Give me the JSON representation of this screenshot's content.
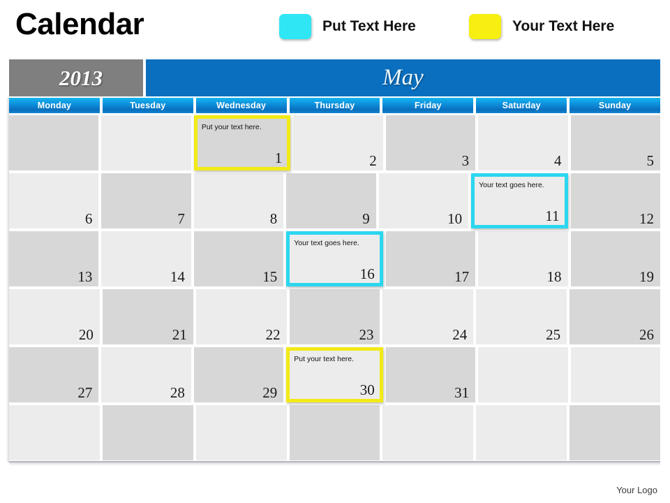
{
  "slide": {
    "title": "Calendar",
    "footer_logo": "Your Logo"
  },
  "legend": {
    "items": [
      {
        "label": "Put Text Here",
        "color": "#2fe6f5",
        "name": "cyan"
      },
      {
        "label": "Your Text Here",
        "color": "#f6ef10",
        "name": "yellow"
      }
    ]
  },
  "header": {
    "year": "2013",
    "month": "May",
    "year_bg": "#7f7f7f",
    "month_bg": "#0a6fbe"
  },
  "weekdays": [
    "Monday",
    "Tuesday",
    "Wednesday",
    "Thursday",
    "Friday",
    "Saturday",
    "Sunday"
  ],
  "notes": {
    "yellow_note": "Put your text here.",
    "cyan_note": "Your text goes here."
  },
  "weeks": [
    [
      {
        "day": "",
        "tone": "dark",
        "highlight": "none",
        "note": ""
      },
      {
        "day": "",
        "tone": "light",
        "highlight": "none",
        "note": ""
      },
      {
        "day": "1",
        "tone": "dark",
        "highlight": "yellow",
        "note": "Put your text here."
      },
      {
        "day": "2",
        "tone": "light",
        "highlight": "none",
        "note": ""
      },
      {
        "day": "3",
        "tone": "dark",
        "highlight": "none",
        "note": ""
      },
      {
        "day": "4",
        "tone": "light",
        "highlight": "none",
        "note": ""
      },
      {
        "day": "5",
        "tone": "dark",
        "highlight": "none",
        "note": ""
      }
    ],
    [
      {
        "day": "6",
        "tone": "light",
        "highlight": "none",
        "note": ""
      },
      {
        "day": "7",
        "tone": "dark",
        "highlight": "none",
        "note": ""
      },
      {
        "day": "8",
        "tone": "light",
        "highlight": "none",
        "note": ""
      },
      {
        "day": "9",
        "tone": "dark",
        "highlight": "none",
        "note": ""
      },
      {
        "day": "10",
        "tone": "light",
        "highlight": "none",
        "note": ""
      },
      {
        "day": "11",
        "tone": "light",
        "highlight": "cyan",
        "note": "Your text goes here."
      },
      {
        "day": "12",
        "tone": "dark",
        "highlight": "none",
        "note": ""
      }
    ],
    [
      {
        "day": "13",
        "tone": "dark",
        "highlight": "none",
        "note": ""
      },
      {
        "day": "14",
        "tone": "light",
        "highlight": "none",
        "note": ""
      },
      {
        "day": "15",
        "tone": "dark",
        "highlight": "none",
        "note": ""
      },
      {
        "day": "16",
        "tone": "light",
        "highlight": "cyan",
        "note": "Your text goes here."
      },
      {
        "day": "17",
        "tone": "dark",
        "highlight": "none",
        "note": ""
      },
      {
        "day": "18",
        "tone": "light",
        "highlight": "none",
        "note": ""
      },
      {
        "day": "19",
        "tone": "dark",
        "highlight": "none",
        "note": ""
      }
    ],
    [
      {
        "day": "20",
        "tone": "light",
        "highlight": "none",
        "note": ""
      },
      {
        "day": "21",
        "tone": "dark",
        "highlight": "none",
        "note": ""
      },
      {
        "day": "22",
        "tone": "light",
        "highlight": "none",
        "note": ""
      },
      {
        "day": "23",
        "tone": "dark",
        "highlight": "none",
        "note": ""
      },
      {
        "day": "24",
        "tone": "light",
        "highlight": "none",
        "note": ""
      },
      {
        "day": "25",
        "tone": "light",
        "highlight": "none",
        "note": ""
      },
      {
        "day": "26",
        "tone": "dark",
        "highlight": "none",
        "note": ""
      }
    ],
    [
      {
        "day": "27",
        "tone": "dark",
        "highlight": "none",
        "note": ""
      },
      {
        "day": "28",
        "tone": "light",
        "highlight": "none",
        "note": ""
      },
      {
        "day": "29",
        "tone": "dark",
        "highlight": "none",
        "note": ""
      },
      {
        "day": "30",
        "tone": "light",
        "highlight": "yellow",
        "note": "Put your text here."
      },
      {
        "day": "31",
        "tone": "dark",
        "highlight": "none",
        "note": ""
      },
      {
        "day": "",
        "tone": "light",
        "highlight": "none",
        "note": ""
      },
      {
        "day": "",
        "tone": "light",
        "highlight": "none",
        "note": ""
      }
    ],
    [
      {
        "day": "",
        "tone": "light",
        "highlight": "none",
        "note": ""
      },
      {
        "day": "",
        "tone": "dark",
        "highlight": "none",
        "note": ""
      },
      {
        "day": "",
        "tone": "light",
        "highlight": "none",
        "note": ""
      },
      {
        "day": "",
        "tone": "dark",
        "highlight": "none",
        "note": ""
      },
      {
        "day": "",
        "tone": "light",
        "highlight": "none",
        "note": ""
      },
      {
        "day": "",
        "tone": "light",
        "highlight": "none",
        "note": ""
      },
      {
        "day": "",
        "tone": "dark",
        "highlight": "none",
        "note": ""
      }
    ]
  ]
}
